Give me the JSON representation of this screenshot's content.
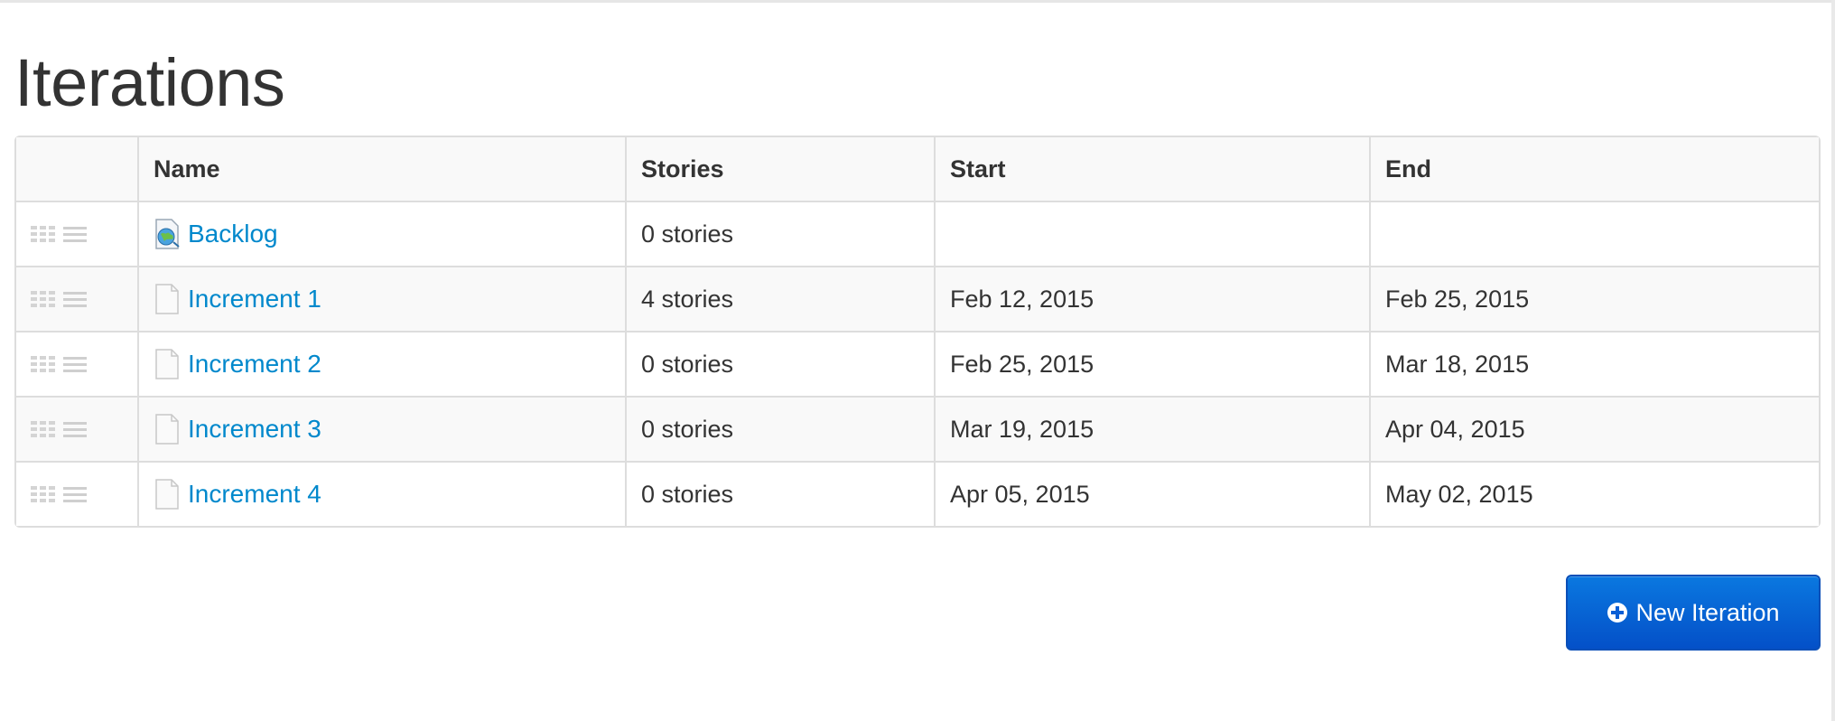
{
  "page": {
    "title": "Iterations"
  },
  "table": {
    "headers": {
      "handle": "",
      "name": "Name",
      "stories": "Stories",
      "start": "Start",
      "end": "End"
    },
    "rows": [
      {
        "name": "Backlog",
        "icon": "backlog-globe-icon",
        "stories": "0 stories",
        "start": "",
        "end": ""
      },
      {
        "name": "Increment 1",
        "icon": "document-icon",
        "stories": "4 stories",
        "start": "Feb 12, 2015",
        "end": "Feb 25, 2015"
      },
      {
        "name": "Increment 2",
        "icon": "document-icon",
        "stories": "0 stories",
        "start": "Feb 25, 2015",
        "end": "Mar 18, 2015"
      },
      {
        "name": "Increment 3",
        "icon": "document-icon",
        "stories": "0 stories",
        "start": "Mar 19, 2015",
        "end": "Apr 04, 2015"
      },
      {
        "name": "Increment 4",
        "icon": "document-icon",
        "stories": "0 stories",
        "start": "Apr 05, 2015",
        "end": "May 02, 2015"
      }
    ]
  },
  "actions": {
    "new_iteration_label": "New Iteration",
    "new_iteration_icon": "plus-circle-icon"
  },
  "colors": {
    "link": "#0088cc",
    "primary_button": "#0a5fd6",
    "table_border": "#dddddd",
    "stripe": "#f9f9f9"
  }
}
